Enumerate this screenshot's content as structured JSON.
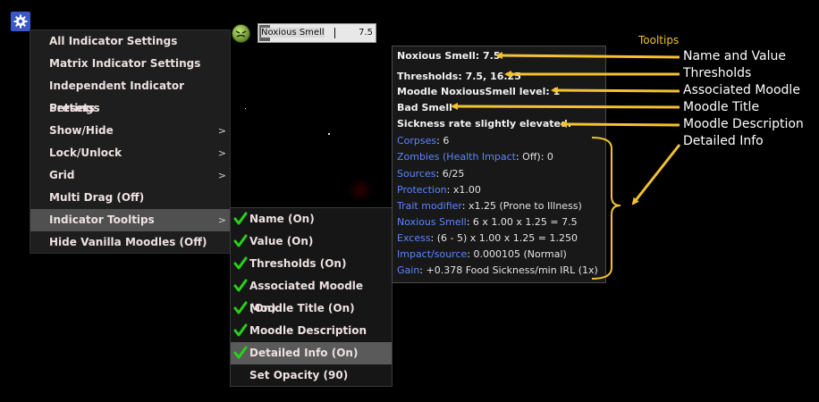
{
  "gear_icon": "gear-icon",
  "colors": {
    "accent_yellow": "#f2c230",
    "link_blue": "#5b85ff",
    "check_green": "#27d11b",
    "highlight": "#505050"
  },
  "menu": {
    "items": [
      {
        "label": "All Indicator Settings",
        "arrow": ""
      },
      {
        "label": "Matrix Indicator Settings",
        "arrow": ""
      },
      {
        "label": "Independent Indicator Settings",
        "arrow": ""
      },
      {
        "label": "Presets",
        "arrow": ""
      },
      {
        "label": "Show/Hide",
        "arrow": ">"
      },
      {
        "label": "Lock/Unlock",
        "arrow": ">"
      },
      {
        "label": "Grid",
        "arrow": ">"
      },
      {
        "label": "Multi Drag (Off)",
        "arrow": ""
      },
      {
        "label": "Indicator Tooltips",
        "arrow": ">"
      },
      {
        "label": "Hide Vanilla Moodles (Off)",
        "arrow": ""
      }
    ]
  },
  "submenu": {
    "items": [
      {
        "label": "Name (On)",
        "checked": true
      },
      {
        "label": "Value (On)",
        "checked": true
      },
      {
        "label": "Thresholds (On)",
        "checked": true
      },
      {
        "label": "Associated Moodle (On)",
        "checked": true
      },
      {
        "label": "Moodle Title (On)",
        "checked": true
      },
      {
        "label": "Moodle Description (On)",
        "checked": true
      },
      {
        "label": "Detailed Info (On)",
        "checked": true
      },
      {
        "label": "Set Opacity (90)",
        "checked": false
      }
    ]
  },
  "indicator": {
    "name": "Noxious Smell",
    "value": "7.5",
    "fill_fraction": 0.09
  },
  "tooltip": {
    "name_value": "Noxious Smell: 7.5",
    "thresholds": "Thresholds: 7.5, 16.25",
    "moodle_level": "Moodle NoxiousSmell level: 1",
    "moodle_title": "Bad Smell",
    "moodle_description": "Sickness rate slightly elevated.",
    "details": [
      {
        "key": "Corpses",
        "rest": ": 6"
      },
      {
        "key": "Zombies (Health Impact",
        "rest": ": Off): 0"
      },
      {
        "key": "Sources",
        "rest": ": 6/25"
      },
      {
        "key": "Protection",
        "rest": ": x1.00"
      },
      {
        "key": "Trait modifier",
        "rest": ": x1.25 (Prone to Illness)"
      },
      {
        "key": "Noxious Smell",
        "rest": ": 6 x 1.00 x 1.25 = 7.5"
      },
      {
        "key": "Excess",
        "rest": ": (6 - 5) x 1.00 x 1.25 = 1.250"
      },
      {
        "key": "Impact/source",
        "rest": ": 0.000105 (Normal)"
      },
      {
        "key": "Gain",
        "rest": ": +0.378 Food Sickness/min IRL (1x)"
      }
    ]
  },
  "annotations": {
    "title": "Tooltips",
    "labels": [
      "Name and Value",
      "Thresholds",
      "Associated Moodle",
      "Moodle Title",
      "Moodle Description",
      "Detailed Info"
    ]
  }
}
